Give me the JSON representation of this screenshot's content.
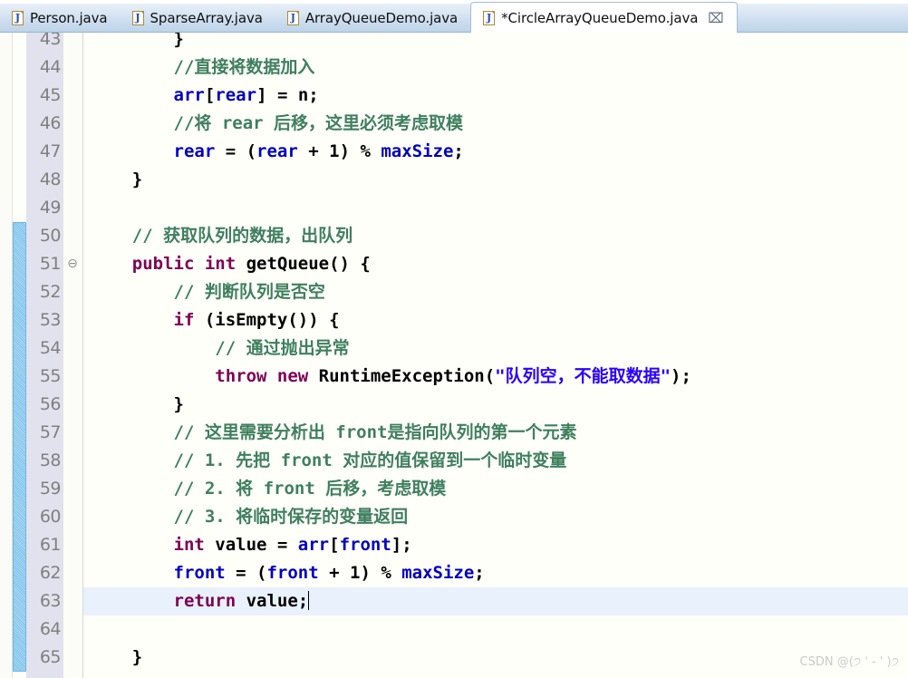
{
  "tabbar": {
    "icon_name": "java-file-icon",
    "icon_char": "J",
    "close_glyph": "⌧",
    "tabs": [
      {
        "label": "Person.java",
        "active": false,
        "dirty": false
      },
      {
        "label": "SparseArray.java",
        "active": false,
        "dirty": false
      },
      {
        "label": "ArrayQueueDemo.java",
        "active": false,
        "dirty": false
      },
      {
        "label": "*CircleArrayQueueDemo.java",
        "active": true,
        "dirty": true
      }
    ]
  },
  "editor": {
    "language": "java",
    "current_line": 63,
    "change_bar_lines": [
      50,
      65
    ],
    "fold_marker_line": 51,
    "fold_glyph": "⊖",
    "colors": {
      "keyword": "#7f0055",
      "field": "#0000c0",
      "comment": "#3f7f5f",
      "string": "#2a00ff",
      "plain": "#000000",
      "line_number": "#808080",
      "gutter_bg": "#e2e2ee",
      "editor_bg": "#fffffa",
      "current_line_bg": "#e8f1fc",
      "change_bar": "#7cc0ea"
    },
    "lines": [
      {
        "n": 43,
        "partial": true,
        "tokens": [
          {
            "t": "pln",
            "s": "        }"
          }
        ]
      },
      {
        "n": 44,
        "tokens": [
          {
            "t": "com",
            "s": "        //直接将数据加入"
          }
        ]
      },
      {
        "n": 45,
        "tokens": [
          {
            "t": "fld",
            "s": "        arr"
          },
          {
            "t": "pln",
            "s": "["
          },
          {
            "t": "fld",
            "s": "rear"
          },
          {
            "t": "pln",
            "s": "] = n;"
          }
        ]
      },
      {
        "n": 46,
        "tokens": [
          {
            "t": "com",
            "s": "        //将 rear 后移，这里必须考虑取模"
          }
        ]
      },
      {
        "n": 47,
        "tokens": [
          {
            "t": "fld",
            "s": "        rear "
          },
          {
            "t": "pln",
            "s": "= ("
          },
          {
            "t": "fld",
            "s": "rear"
          },
          {
            "t": "pln",
            "s": " + 1) % "
          },
          {
            "t": "fld",
            "s": "maxSize"
          },
          {
            "t": "pln",
            "s": ";"
          }
        ]
      },
      {
        "n": 48,
        "tokens": [
          {
            "t": "pln",
            "s": "    }"
          }
        ]
      },
      {
        "n": 49,
        "tokens": [
          {
            "t": "pln",
            "s": ""
          }
        ]
      },
      {
        "n": 50,
        "tokens": [
          {
            "t": "com",
            "s": "    // 获取队列的数据，出队列"
          }
        ]
      },
      {
        "n": 51,
        "tokens": [
          {
            "t": "kw",
            "s": "    public int "
          },
          {
            "t": "pln",
            "s": "getQueue() {"
          }
        ]
      },
      {
        "n": 52,
        "tokens": [
          {
            "t": "com",
            "s": "        // 判断队列是否空"
          }
        ]
      },
      {
        "n": 53,
        "tokens": [
          {
            "t": "kw",
            "s": "        if "
          },
          {
            "t": "pln",
            "s": "(isEmpty()) {"
          }
        ]
      },
      {
        "n": 54,
        "tokens": [
          {
            "t": "com",
            "s": "            // 通过抛出异常"
          }
        ]
      },
      {
        "n": 55,
        "tokens": [
          {
            "t": "kw",
            "s": "            throw new "
          },
          {
            "t": "pln",
            "s": "RuntimeException("
          },
          {
            "t": "str",
            "s": "\"队列空，不能取数据\""
          },
          {
            "t": "pln",
            "s": ");"
          }
        ]
      },
      {
        "n": 56,
        "tokens": [
          {
            "t": "pln",
            "s": "        }"
          }
        ]
      },
      {
        "n": 57,
        "tokens": [
          {
            "t": "com",
            "s": "        // 这里需要分析出 front是指向队列的第一个元素"
          }
        ]
      },
      {
        "n": 58,
        "tokens": [
          {
            "t": "com",
            "s": "        // 1. 先把 front 对应的值保留到一个临时变量"
          }
        ]
      },
      {
        "n": 59,
        "tokens": [
          {
            "t": "com",
            "s": "        // 2. 将 front 后移，考虑取模"
          }
        ]
      },
      {
        "n": 60,
        "tokens": [
          {
            "t": "com",
            "s": "        // 3. 将临时保存的变量返回"
          }
        ]
      },
      {
        "n": 61,
        "tokens": [
          {
            "t": "kw",
            "s": "        int "
          },
          {
            "t": "pln",
            "s": "value = "
          },
          {
            "t": "fld",
            "s": "arr"
          },
          {
            "t": "pln",
            "s": "["
          },
          {
            "t": "fld",
            "s": "front"
          },
          {
            "t": "pln",
            "s": "];"
          }
        ]
      },
      {
        "n": 62,
        "tokens": [
          {
            "t": "fld",
            "s": "        front "
          },
          {
            "t": "pln",
            "s": "= ("
          },
          {
            "t": "fld",
            "s": "front"
          },
          {
            "t": "pln",
            "s": " + 1) % "
          },
          {
            "t": "fld",
            "s": "maxSize"
          },
          {
            "t": "pln",
            "s": ";"
          }
        ]
      },
      {
        "n": 63,
        "caret": true,
        "tokens": [
          {
            "t": "kw",
            "s": "        return "
          },
          {
            "t": "pln",
            "s": "value;"
          }
        ]
      },
      {
        "n": 64,
        "tokens": [
          {
            "t": "pln",
            "s": ""
          }
        ]
      },
      {
        "n": 65,
        "tokens": [
          {
            "t": "pln",
            "s": "    }"
          }
        ]
      }
    ]
  },
  "watermark": {
    "text": "CSDN @(੭ ' - ' )੭"
  }
}
